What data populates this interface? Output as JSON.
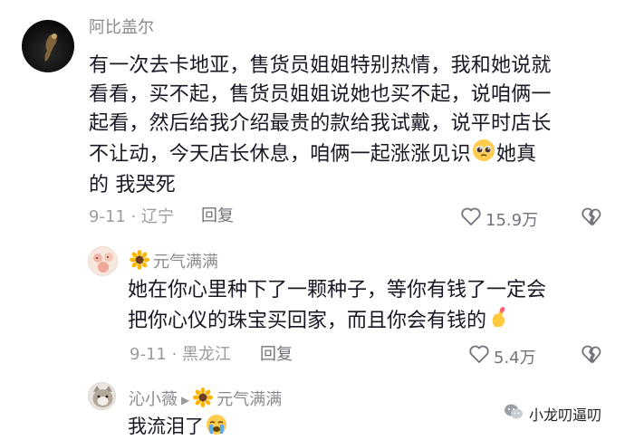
{
  "comments": [
    {
      "author": "阿比盖尔",
      "text_lines": [
        "有一次去卡地亚，售货员姐姐特别热情，我和她说就",
        "看看，买不起，售货员姐姐说她也买不起，说咱俩一",
        "起看，然后给我介绍最贵的款给我试戴，说平时店长",
        "不让动，今天店长休息，咱俩一起涨涨见识",
        "她真",
        "的 我哭死"
      ],
      "date_location": "9-11 · 辽宁",
      "reply_label": "回复",
      "likes": "15.9万"
    },
    {
      "author": "元气满满",
      "text_lines": [
        "她在你心里种下了一颗种子，等你有钱了一定会",
        "把你心仪的珠宝买回家，而且你会有钱的"
      ],
      "date_location": "9-11 · 黑龙江",
      "reply_label": "回复",
      "likes": "5.4万"
    },
    {
      "author": "沁小薇",
      "reply_to": "元气满满",
      "text": "我流泪了"
    }
  ],
  "watermark": "小龙叨逼叨",
  "icons": {
    "like": "heart-outline-icon",
    "dislike": "broken-heart-icon",
    "sunflower": "sunflower-icon",
    "pleading": "pleading-face-icon",
    "finger_heart": "finger-heart-icon",
    "crying": "loudly-crying-face-icon",
    "reply_arrow": "reply-arrow-icon",
    "wechat": "wechat-icon"
  },
  "colors": {
    "text": "#161823",
    "meta": "#9a9ba0",
    "author": "#8a8b91"
  }
}
